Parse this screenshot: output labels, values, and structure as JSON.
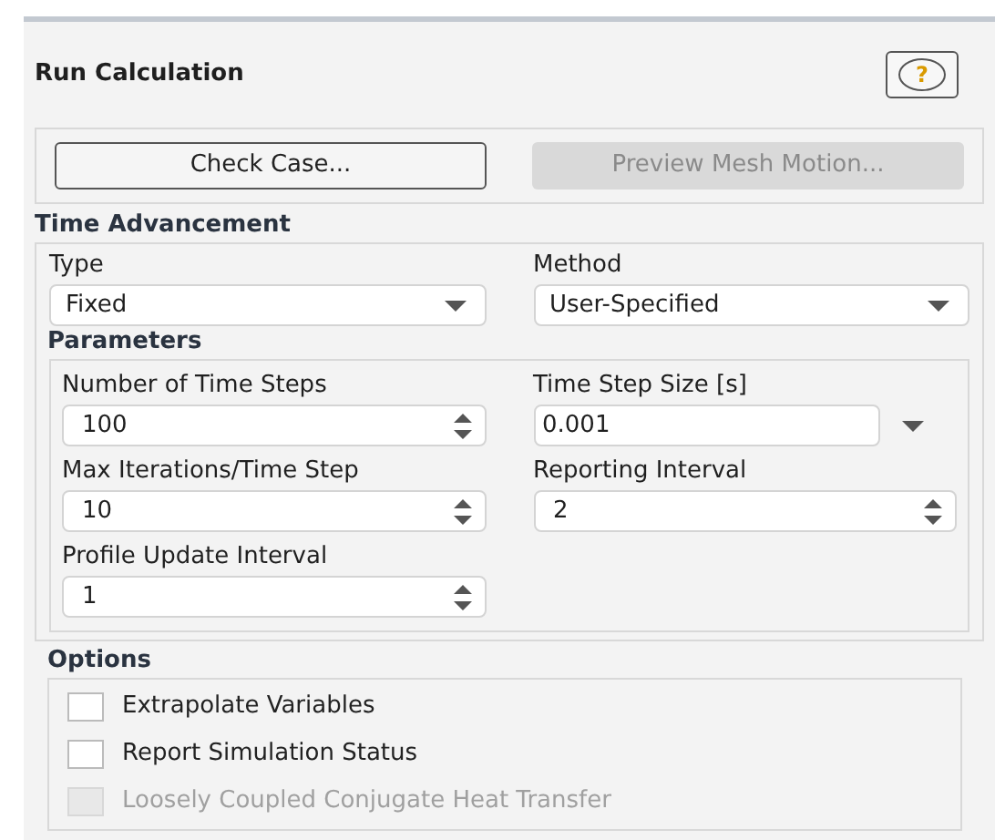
{
  "title": "Run Calculation",
  "help_button": {
    "label": "?"
  },
  "buttons": [
    {
      "label": "Check Case...",
      "disabled": false
    },
    {
      "label": "Preview Mesh Motion...",
      "disabled": true
    }
  ],
  "time_advancement": {
    "heading": "Time Advancement",
    "dropdowns": [
      {
        "label": "Type",
        "value": "Fixed"
      },
      {
        "label": "Method",
        "value": "User-Specified"
      }
    ]
  },
  "parameters": {
    "heading": "Parameters",
    "fields": [
      {
        "label": "Number of Time Steps",
        "value": "100",
        "kind": "spinner"
      },
      {
        "label": "Time Step Size [s]",
        "value": "0.001",
        "kind": "expression"
      },
      {
        "label": "Max Iterations/Time Step",
        "value": "10",
        "kind": "spinner"
      },
      {
        "label": "Reporting Interval",
        "value": "2",
        "kind": "spinner"
      },
      {
        "label": "Profile Update Interval",
        "value": "1",
        "kind": "spinner"
      }
    ]
  },
  "options": {
    "heading": "Options",
    "items": [
      {
        "label": "Extrapolate Variables",
        "checked": false,
        "disabled": false
      },
      {
        "label": "Report Simulation Status",
        "checked": false,
        "disabled": false
      },
      {
        "label": "Loosely Coupled Conjugate Heat Transfer",
        "checked": false,
        "disabled": true
      }
    ]
  }
}
